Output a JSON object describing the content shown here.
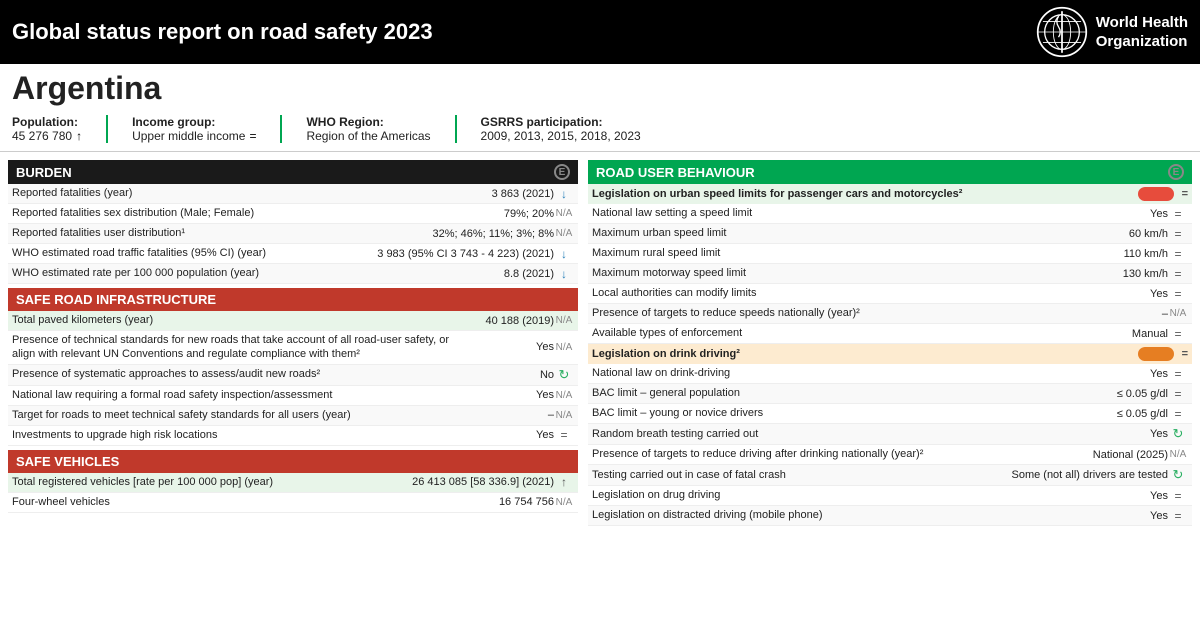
{
  "header": {
    "title": "Global status report on road safety 2023",
    "who_name": "World Health\nOrganization"
  },
  "country": {
    "name": "Argentina"
  },
  "stats": [
    {
      "label": "Population:",
      "value": "45 276 780",
      "icon": "↑"
    },
    {
      "label": "Income group:",
      "value": "Upper middle income",
      "icon": "="
    },
    {
      "label": "WHO Region:",
      "value": "Region of the Americas",
      "icon": ""
    },
    {
      "label": "GSRRS participation:",
      "value": "2009, 2013, 2015, 2018, 2023",
      "icon": ""
    }
  ],
  "burden": {
    "section_label": "BURDEN",
    "rows": [
      {
        "label": "Reported fatalities (year)",
        "value": "3 863 (2021)",
        "icon": "↓"
      },
      {
        "label": "Reported fatalities sex distribution (Male; Female)",
        "value": "79%; 20%",
        "icon": "N/A"
      },
      {
        "label": "Reported fatalities user distribution¹",
        "value": "32%; 46%; 11%; 3%; 8%",
        "icon": "N/A"
      },
      {
        "label": "WHO estimated road traffic fatalities (95% CI) (year)",
        "value": "3 983 (95% CI 3 743 - 4 223) (2021)",
        "icon": "↓"
      },
      {
        "label": "WHO estimated rate per 100 000 population (year)",
        "value": "8.8 (2021)",
        "icon": "↓"
      }
    ]
  },
  "safe_road": {
    "section_label": "SAFE ROAD INFRASTRUCTURE",
    "rows": [
      {
        "label": "Total paved kilometers (year)",
        "value": "40 188 (2019)",
        "icon": "N/A",
        "highlighted": true
      },
      {
        "label": "Presence of technical standards for new roads that take account of all road-user safety, or align with relevant UN Conventions and regulate compliance with them²",
        "value": "Yes",
        "icon": "N/A"
      },
      {
        "label": "Presence of systematic approaches to assess/audit new roads²",
        "value": "No",
        "icon": "↻"
      },
      {
        "label": "National law requiring a formal road safety inspection/assessment",
        "value": "Yes",
        "icon": "N/A"
      },
      {
        "label": "Target for roads to meet technical safety standards for all users (year)",
        "value": "–",
        "icon": "N/A"
      },
      {
        "label": "Investments to upgrade high risk locations",
        "value": "Yes",
        "icon": "="
      }
    ]
  },
  "safe_vehicles": {
    "section_label": "SAFE VEHICLES",
    "rows": [
      {
        "label": "Total registered vehicles [rate per 100 000 pop] (year)",
        "value": "26 413 085 [58 336.9] (2021)",
        "icon": "↑",
        "highlighted": true
      },
      {
        "label": "Four-wheel vehicles",
        "value": "16 754 756",
        "icon": "N/A"
      }
    ]
  },
  "road_user": {
    "section_label": "ROAD USER BEHAVIOUR",
    "subsections": [
      {
        "label": "Legislation on urban speed limits for passenger cars and motorcycles²",
        "indicator": "red",
        "icon": "=",
        "rows": [
          {
            "label": "National law setting a speed limit",
            "value": "Yes",
            "icon": "="
          },
          {
            "label": "Maximum urban speed limit",
            "value": "60 km/h",
            "icon": "="
          },
          {
            "label": "Maximum rural speed limit",
            "value": "110 km/h",
            "icon": "="
          },
          {
            "label": "Maximum motorway speed limit",
            "value": "130 km/h",
            "icon": "="
          },
          {
            "label": "Local authorities can modify limits",
            "value": "Yes",
            "icon": "="
          },
          {
            "label": "Presence of targets to reduce speeds nationally (year)²",
            "value": "–",
            "icon": "N/A"
          },
          {
            "label": "Available types of enforcement",
            "value": "Manual",
            "icon": "="
          }
        ]
      },
      {
        "label": "Legislation on drink driving²",
        "indicator": "orange",
        "icon": "=",
        "rows": [
          {
            "label": "National law on drink-driving",
            "value": "Yes",
            "icon": "="
          },
          {
            "label": "BAC limit – general population",
            "value": "≤ 0.05 g/dl",
            "icon": "="
          },
          {
            "label": "BAC limit – young or novice drivers",
            "value": "≤ 0.05 g/dl",
            "icon": "="
          },
          {
            "label": "Random breath testing carried out",
            "value": "Yes",
            "icon": "↻"
          },
          {
            "label": "Presence of targets to reduce driving after drinking nationally (year)²",
            "value": "National (2025)",
            "icon": "N/A"
          },
          {
            "label": "Testing carried out in case of fatal crash",
            "value": "Some (not all) drivers are tested",
            "icon": "↻"
          }
        ]
      },
      {
        "label": "Legislation on drug driving",
        "indicator": null,
        "icon": "=",
        "rows": [
          {
            "label": "Legislation on drug driving",
            "value": "Yes",
            "icon": "="
          }
        ]
      },
      {
        "label": "Legislation on distracted driving (mobile phone)",
        "indicator": null,
        "icon": "=",
        "rows": [
          {
            "label": "Legislation on distracted driving (mobile phone)",
            "value": "Yes",
            "icon": "="
          }
        ]
      }
    ]
  },
  "icons": {
    "info": "ⓘ",
    "down_arrow": "↓",
    "up_arrow": "↑",
    "equals": "=",
    "na": "N/A",
    "refresh": "↻"
  }
}
